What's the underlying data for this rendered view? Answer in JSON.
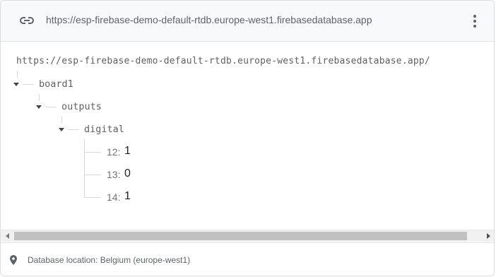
{
  "header": {
    "url": "https://esp-firebase-demo-default-rtdb.europe-west1.firebasedatabase.app",
    "link_icon": "link-icon",
    "more_icon": "more-vert-icon"
  },
  "tree": {
    "root_url": "https://esp-firebase-demo-default-rtdb.europe-west1.firebasedatabase.app/",
    "nodes": [
      {
        "key": "board1",
        "expanded": true
      },
      {
        "key": "outputs",
        "expanded": true
      },
      {
        "key": "digital",
        "expanded": true
      }
    ],
    "leaves": [
      {
        "key": "12:",
        "value": "1"
      },
      {
        "key": "13:",
        "value": "0"
      },
      {
        "key": "14:",
        "value": "1"
      }
    ]
  },
  "footer": {
    "location_text": "Database location: Belgium (europe-west1)",
    "icon": "location-pin-icon"
  }
}
